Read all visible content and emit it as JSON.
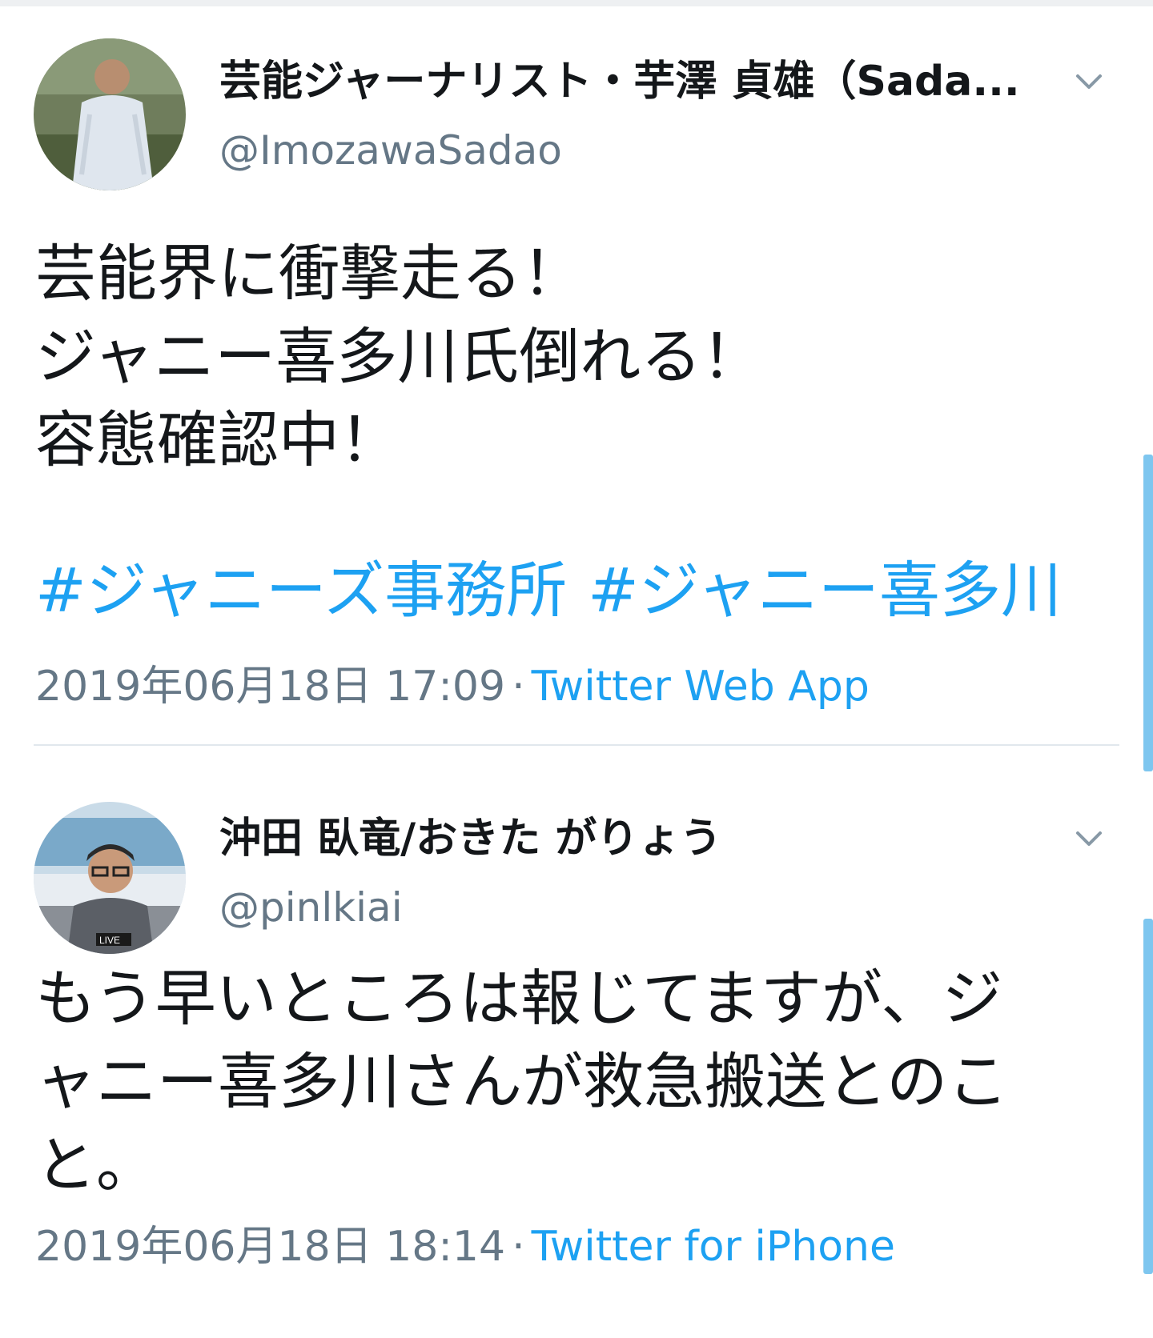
{
  "tweets": [
    {
      "display_name": "芸能ジャーナリスト・芋澤 貞雄（Sada...",
      "handle": "@ImozawaSadao",
      "text_lines": [
        "芸能界に衝撃走る！",
        "ジャニー喜多川氏倒れる！",
        "容態確認中！"
      ],
      "hashtags": [
        "#ジャニーズ事務所",
        "#ジャニー喜多川"
      ],
      "timestamp": "2019年06月18日 17:09",
      "separator": "·",
      "source": "Twitter Web App",
      "menu_icon": "chevron-down-icon"
    },
    {
      "display_name": "沖田 臥竜/おきた がりょう",
      "handle": "@pinlkiai",
      "text_lines": [
        "もう早いところは報じてますが、ジ",
        "ャニー喜多川さんが救急搬送とのこ",
        "と。"
      ],
      "timestamp": "2019年06月18日 18:14",
      "separator": "·",
      "source": "Twitter for iPhone",
      "menu_icon": "chevron-down-icon",
      "avatar_text": "LIVE"
    }
  ],
  "colors": {
    "link": "#1da1f2",
    "muted": "#657786",
    "text": "#14171a",
    "divider": "#e1e8ed",
    "scrollbar": "#7ec6ef"
  }
}
